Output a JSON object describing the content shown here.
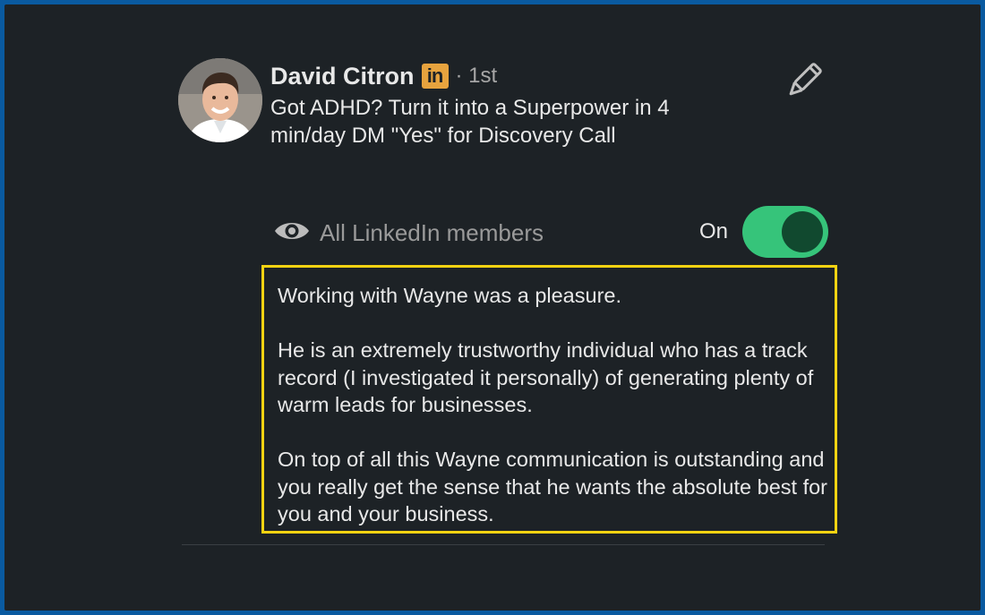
{
  "profile": {
    "name": "David Citron",
    "badge": "in",
    "degree": "· 1st",
    "headline": "Got ADHD? Turn it into a Superpower in 4 min/day DM \"Yes\" for Discovery Call"
  },
  "visibility": {
    "label": "All LinkedIn members",
    "toggle_label": "On",
    "toggle_on": true
  },
  "recommendation": {
    "paragraphs": [
      "Working with Wayne was a pleasure.",
      "He is an extremely trustworthy individual who has a track record (I investigated it personally) of generating plenty of warm leads for businesses.",
      "On top of all this Wayne communication is outstanding and you really get the sense that he wants the absolute best for you and your business."
    ]
  },
  "colors": {
    "background": "#1d2226",
    "frame_border": "#0a5aa0",
    "toggle_on": "#36c47a",
    "highlight_box": "#f5d312",
    "linkedin_badge": "#e7a33e"
  }
}
